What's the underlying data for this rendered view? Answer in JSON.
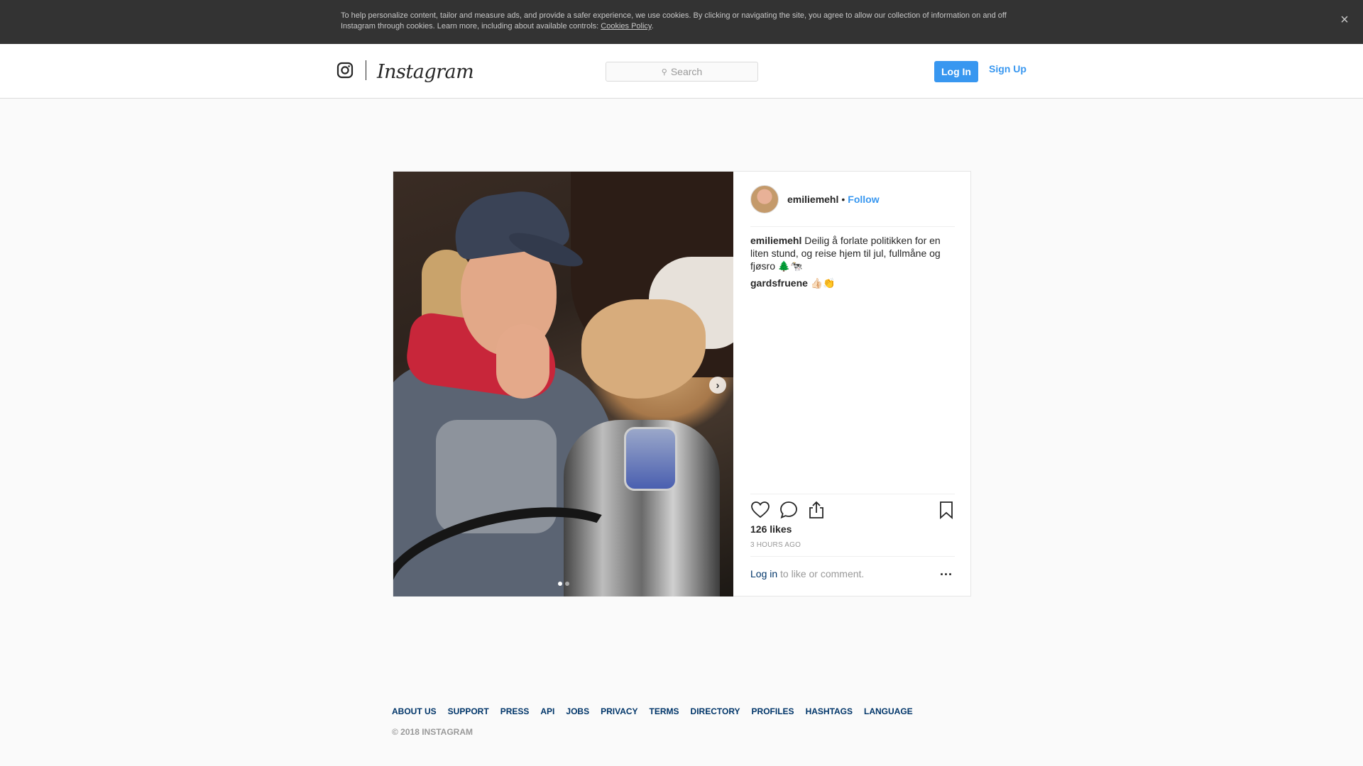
{
  "cookie": {
    "text": "To help personalize content, tailor and measure ads, and provide a safer experience, we use cookies. By clicking or navigating the site, you agree to allow our collection of information on and off Instagram through cookies. Learn more, including about available controls: ",
    "link": "Cookies Policy",
    "close_icon": "close-icon"
  },
  "nav": {
    "wordmark": "Instagram",
    "search_placeholder": "Search",
    "login": "Log In",
    "signup": "Sign Up"
  },
  "post": {
    "username": "emiliemehl",
    "separator": "•",
    "follow": "Follow",
    "caption_user": "emiliemehl",
    "caption_text": " Deilig å forlate politikken for en liten stund, og reise hjem til jul, fullmåne og fjøsro 🌲🐄",
    "comment_user": "gardsfruene",
    "comment_text": " 👍🏻👏",
    "likes": "126 likes",
    "time": "3 HOURS AGO",
    "login_link": "Log in",
    "login_suffix": " to like or comment.",
    "more": "...",
    "carousel_total": 2,
    "carousel_index": 1
  },
  "footer": {
    "links": [
      "ABOUT US",
      "SUPPORT",
      "PRESS",
      "API",
      "JOBS",
      "PRIVACY",
      "TERMS",
      "DIRECTORY",
      "PROFILES",
      "HASHTAGS",
      "LANGUAGE"
    ],
    "copyright": "© 2018 INSTAGRAM"
  },
  "colors": {
    "accent": "#3897f0",
    "link": "#003569",
    "banner": "#333333"
  }
}
